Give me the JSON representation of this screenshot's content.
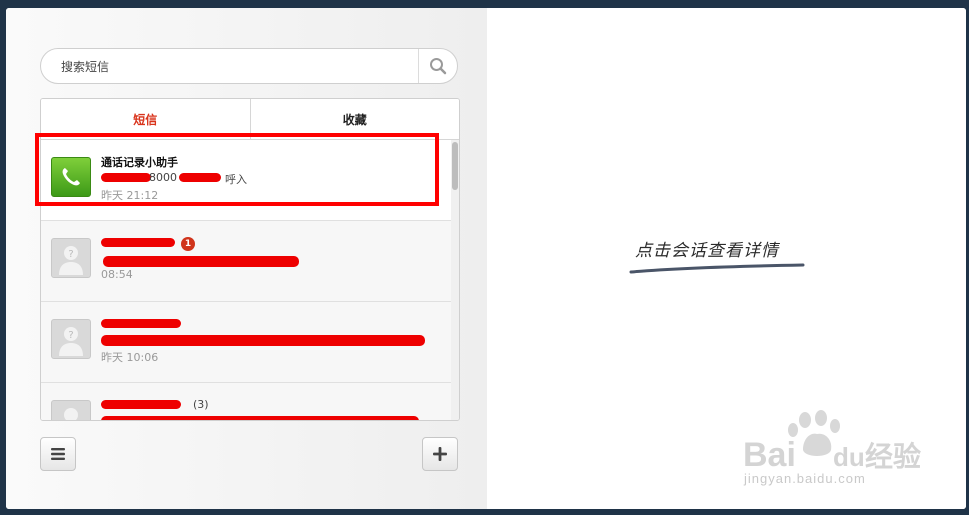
{
  "search": {
    "placeholder": "搜索短信"
  },
  "tabs": [
    {
      "label": "短信",
      "active": true
    },
    {
      "label": "收藏",
      "active": false
    }
  ],
  "messages": [
    {
      "name": "通话记录小助手",
      "preview_mid": "8000",
      "preview_suffix": "呼入",
      "time": "昨天 21:12",
      "avatar": "phone-icon"
    },
    {
      "name": "",
      "badge": "1",
      "time": "08:54",
      "avatar": "person-icon"
    },
    {
      "name": "",
      "time": "昨天 10:06",
      "avatar": "person-icon"
    },
    {
      "name": "",
      "count": "(3)",
      "time": "",
      "avatar": "person-icon"
    }
  ],
  "toolbar": {
    "menu_icon": "menu-icon",
    "add_icon": "plus-icon"
  },
  "detail": {
    "hint": "点击会话查看详情"
  },
  "watermark": {
    "brand": "Baidu经验",
    "url": "jingyan.baidu.com"
  },
  "colors": {
    "accent": "#d9331b",
    "highlight": "#ff0000",
    "redaction": "#ee0000"
  }
}
